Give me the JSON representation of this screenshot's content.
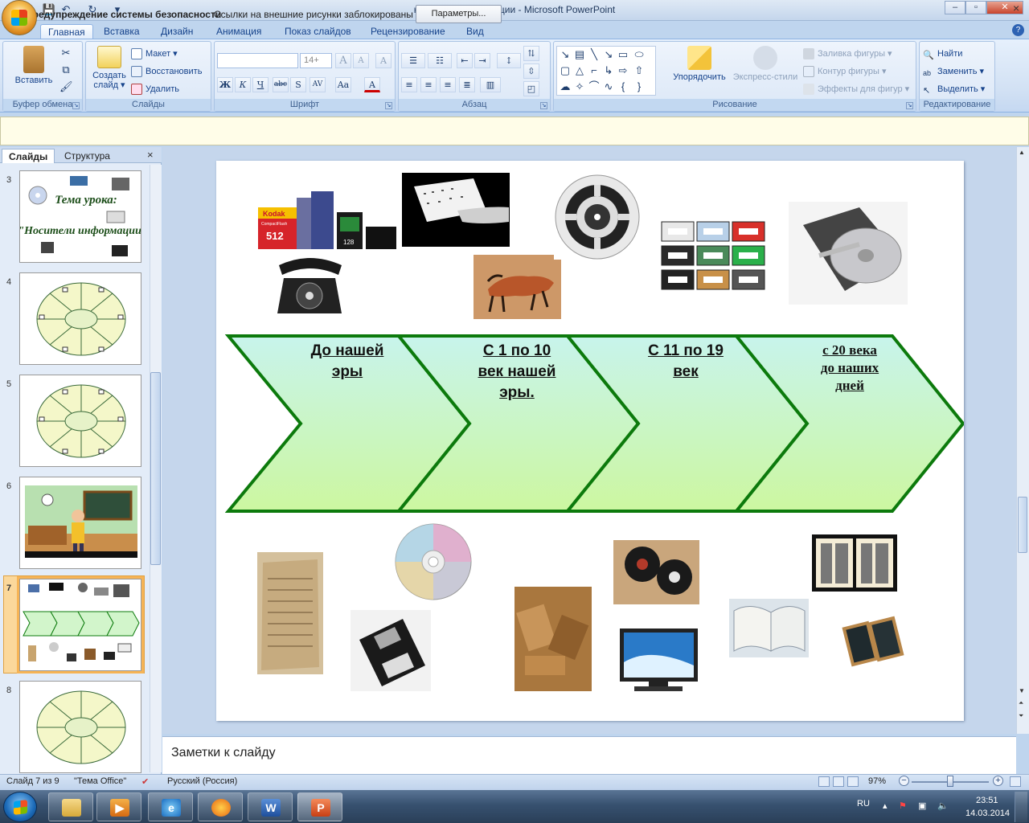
{
  "window": {
    "title": "носители информации - Microsoft PowerPoint",
    "minimize": "–",
    "maximize": "▫",
    "close": "✕"
  },
  "qat": {
    "save": "💾",
    "undo": "↶",
    "redo": "↻",
    "more": "▾"
  },
  "tabs": [
    "Главная",
    "Вставка",
    "Дизайн",
    "Анимация",
    "Показ слайдов",
    "Рецензирование",
    "Вид"
  ],
  "help": "?",
  "ribbon": {
    "clipboard": {
      "label": "Буфер обмена",
      "paste": "Вставить"
    },
    "slides": {
      "label": "Слайды",
      "new_slide": "Создать слайд ▾",
      "layout": "Макет ▾",
      "reset": "Восстановить",
      "delete": "Удалить"
    },
    "font": {
      "label": "Шрифт",
      "font_name": "",
      "font_size": "14+",
      "bold": "Ж",
      "italic": "К",
      "underline": "Ч",
      "strike": "abc",
      "shadow": "S",
      "spacing": "AV",
      "case": "Aa",
      "color": "A",
      "grow": "A",
      "shrink": "A",
      "clear": "A"
    },
    "paragraph": {
      "label": "Абзац"
    },
    "drawing": {
      "label": "Рисование",
      "arrange": "Упорядочить",
      "quick_styles": "Экспресс-стили",
      "fill": "Заливка фигуры ▾",
      "outline": "Контур фигуры ▾",
      "effects": "Эффекты для фигур ▾"
    },
    "editing": {
      "label": "Редактирование",
      "find": "Найти",
      "replace": "Заменить ▾",
      "select": "Выделить ▾"
    }
  },
  "security": {
    "title": "Предупреждение системы безопасности",
    "message": "Ссылки на внешние рисунки заблокированы",
    "button": "Параметры...",
    "close": "×"
  },
  "pane": {
    "tabs": [
      "Слайды",
      "Структура"
    ],
    "close": "×",
    "thumbs": [
      {
        "num": "3",
        "line1": "Тема урока:",
        "line2": "\"Носители информации\""
      },
      {
        "num": "4"
      },
      {
        "num": "5"
      },
      {
        "num": "6"
      },
      {
        "num": "7"
      },
      {
        "num": "8"
      }
    ]
  },
  "slide": {
    "eras": [
      {
        "line1": "До нашей",
        "line2": "эры",
        "line3": ""
      },
      {
        "line1": "С 1 по 10",
        "line2": "век нашей",
        "line3": "эры."
      },
      {
        "line1": "С 11 по 19",
        "line2": "век",
        "line3": ""
      },
      {
        "line1": "с 20 века",
        "line2": "до наших",
        "line3": "дней"
      }
    ],
    "memory_card_labels": {
      "kodak": "Kodak",
      "cf": "CompactFlash",
      "size": "512",
      "sd": "128"
    }
  },
  "notes": {
    "placeholder": "Заметки к слайду"
  },
  "status": {
    "slide": "Слайд 7 из 9",
    "theme": "\"Тема Office\"",
    "language": "Русский (Россия)",
    "zoom": "97%",
    "zoom_fraction": 0.5
  },
  "taskbar": {
    "lang": "RU",
    "time": "23:51",
    "date": "14.03.2014"
  },
  "colors": {
    "arrow_fill_top": "#c8f4ec",
    "arrow_fill_bottom": "#ccf7a0",
    "arrow_stroke": "#0c7a0c",
    "ribbon_bg": "#d2e1f4",
    "selected_thumb": "#f6b456"
  }
}
